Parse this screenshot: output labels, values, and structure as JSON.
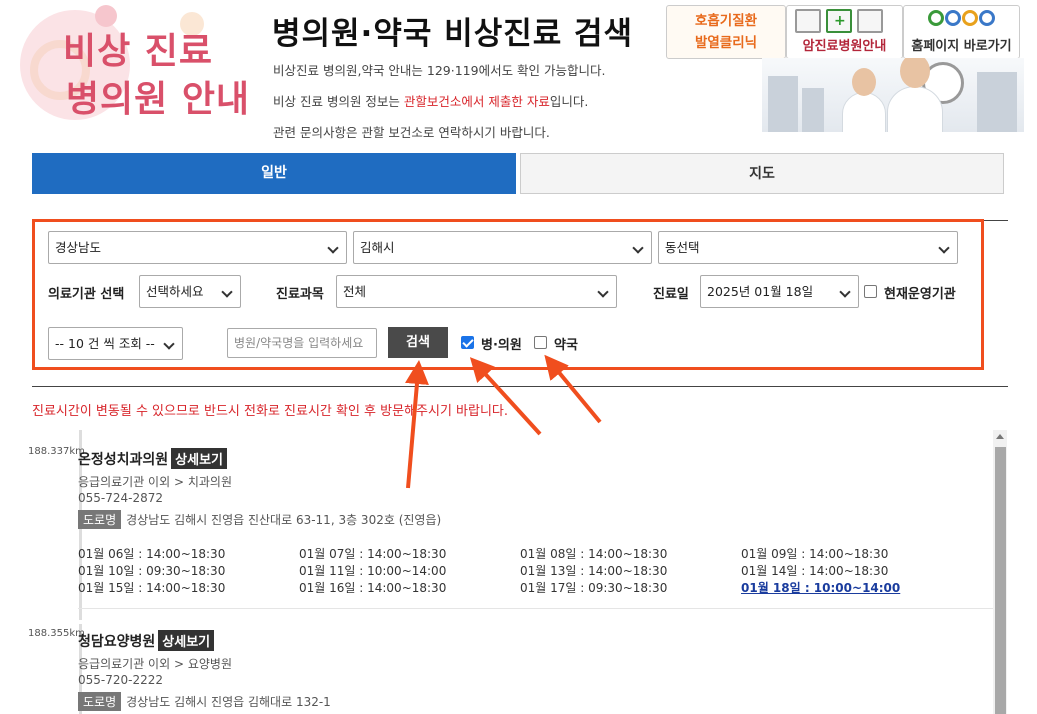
{
  "header": {
    "logo_line1": "비상 진료",
    "logo_line2": "병의원 안내",
    "title": "병의원·약국 비상진료 검색",
    "info1": "비상진료 병의원,약국 안내는 129·119에서도 확인 가능합니다.",
    "info2_pre": "비상 진료 병의원 정보는 ",
    "info2_red": "관할보건소에서 제출한 자료",
    "info2_post": "입니다.",
    "info3": "관련 문의사항은 관할 보건소로 연락하시기 바랍니다."
  },
  "banners": {
    "b1_line1": "호흡기질환",
    "b1_line2": "발열클리닉",
    "b2": "암진료병원안내",
    "b3": "홈페이지 바로가기"
  },
  "tabs": {
    "general": "일반",
    "map": "지도"
  },
  "form": {
    "province": "경상남도",
    "city": "김해시",
    "dong": "동선택",
    "inst_label": "의료기관 선택",
    "inst_value": "선택하세요",
    "dept_label": "진료과목",
    "dept_value": "전체",
    "date_label": "진료일",
    "date_value": "2025년 01월 18일",
    "open_now_label": "현재운영기관",
    "page_size": "-- 10 건 씩 조회 --",
    "name_placeholder": "병원/약국명을 입력하세요",
    "search_label": "검색",
    "clinic_label": "병·의원",
    "pharmacy_label": "약국",
    "clinic_checked": true,
    "pharmacy_checked": false,
    "open_now_checked": false
  },
  "warning": "진료시간이 변동될 수 있으므로 반드시 전화로 진료시간 확인 후 방문해주시기 바랍니다.",
  "results": [
    {
      "distance": "188.337km",
      "name": "온정성치과의원",
      "detail_label": "상세보기",
      "category": "응급의료기관 이외 > 치과의원",
      "phone": "055-724-2872",
      "road_tag": "도로명",
      "address": "경상남도 김해시 진영읍 진산대로 63-11, 3층 302호 (진영읍)",
      "schedule": [
        "01월 06일 : 14:00~18:30",
        "01월 07일 : 14:00~18:30",
        "01월 08일 : 14:00~18:30",
        "01월 09일 : 14:00~18:30",
        "01월 10일 : 09:30~18:30",
        "01월 11일 : 10:00~14:00",
        "01월 13일 : 14:00~18:30",
        "01월 14일 : 14:00~18:30",
        "01월 15일 : 14:00~18:30",
        "01월 16일 : 14:00~18:30",
        "01월 17일 : 09:30~18:30",
        "01월 18일 : 10:00~14:00"
      ]
    },
    {
      "distance": "188.355km",
      "name": "청담요양병원",
      "detail_label": "상세보기",
      "category": "응급의료기관 이외 > 요양병원",
      "phone": "055-720-2222",
      "road_tag": "도로명",
      "address": "경상남도 김해시 진영읍 김해대로 132-1"
    }
  ],
  "colors": {
    "accent_blue": "#1f6cc1",
    "highlight_orange": "#f04e1e",
    "warning_red": "#d8252b"
  }
}
